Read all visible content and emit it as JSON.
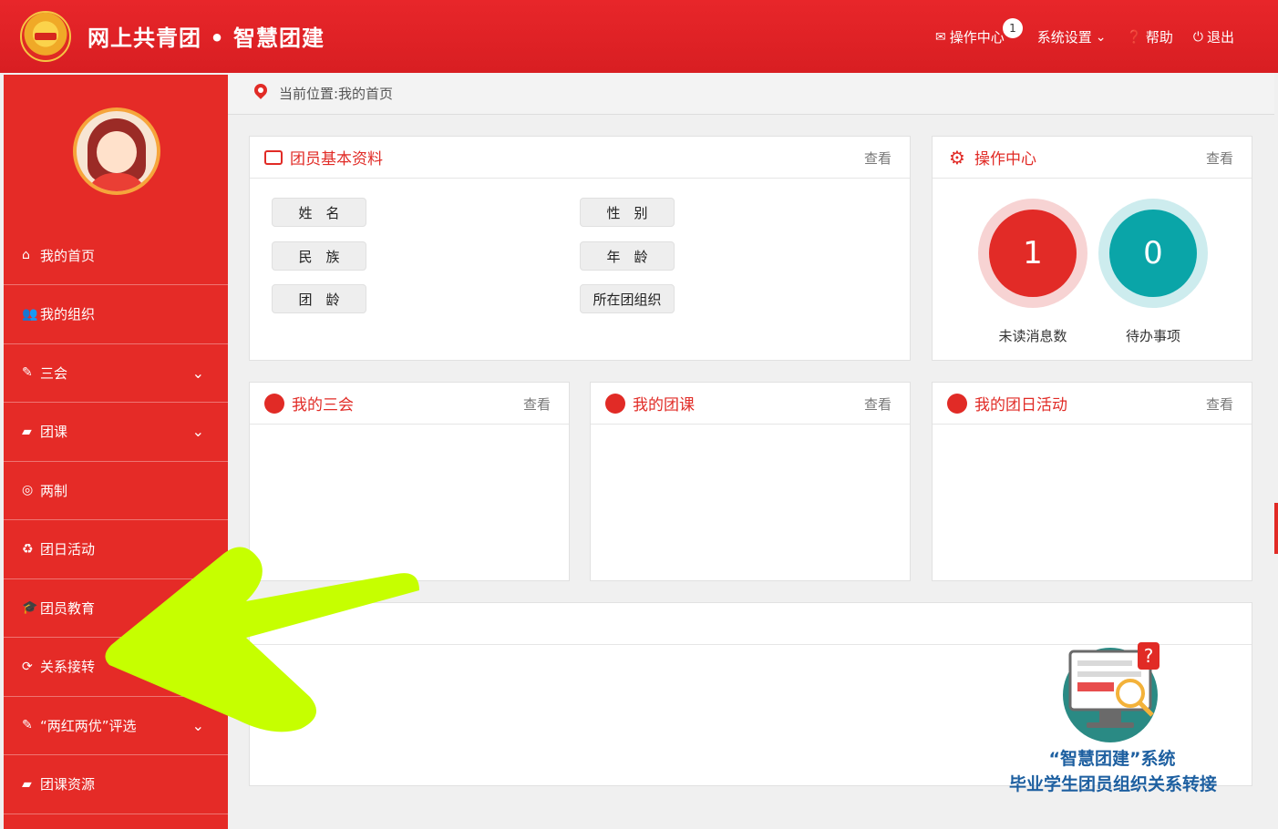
{
  "header": {
    "brand": "网上共青团 • 智慧团建",
    "nav": {
      "ops": "操作中心",
      "ops_badge": "1",
      "settings": "系统设置",
      "help": "帮助",
      "logout": "退出"
    }
  },
  "breadcrumb": "当前位置:我的首页",
  "sidebar": {
    "items": [
      {
        "label": "我的首页",
        "icon": "home-icon"
      },
      {
        "label": "我的组织",
        "icon": "group-icon"
      },
      {
        "label": "三会",
        "icon": "edit-icon"
      },
      {
        "label": "团课",
        "icon": "folder-icon"
      },
      {
        "label": "两制",
        "icon": "target-icon"
      },
      {
        "label": "团日活动",
        "icon": "recycle-icon"
      },
      {
        "label": "团员教育",
        "icon": "graduation-cap-icon"
      },
      {
        "label": "关系接转",
        "icon": "refresh-icon"
      },
      {
        "label": "“两红两优”评选",
        "icon": "edit-icon"
      },
      {
        "label": "团课资源",
        "icon": "folder-icon"
      }
    ]
  },
  "panels": {
    "profile": {
      "title": "团员基本资料",
      "more": "查看",
      "fields": [
        "姓　名",
        "性　别",
        "民　族",
        "年　龄",
        "团　龄",
        "所在团组织"
      ]
    },
    "ops_center": {
      "title": "操作中心",
      "more": "查看",
      "unread_value": "1",
      "unread_label": "未读消息数",
      "todo_value": "0",
      "todo_label": "待办事项"
    },
    "meetings": {
      "title": "我的三会",
      "more": "查看"
    },
    "courses": {
      "title": "我的团课",
      "more": "查看"
    },
    "activities": {
      "title": "我的团日活动",
      "more": "查看"
    }
  },
  "promo": {
    "line1": "“智慧团建”系统",
    "line2": "毕业学生团员组织关系转接"
  },
  "colors": {
    "brand_red": "#e12b26",
    "teal": "#0aa5a8",
    "arrow_green": "#c6ff00"
  }
}
